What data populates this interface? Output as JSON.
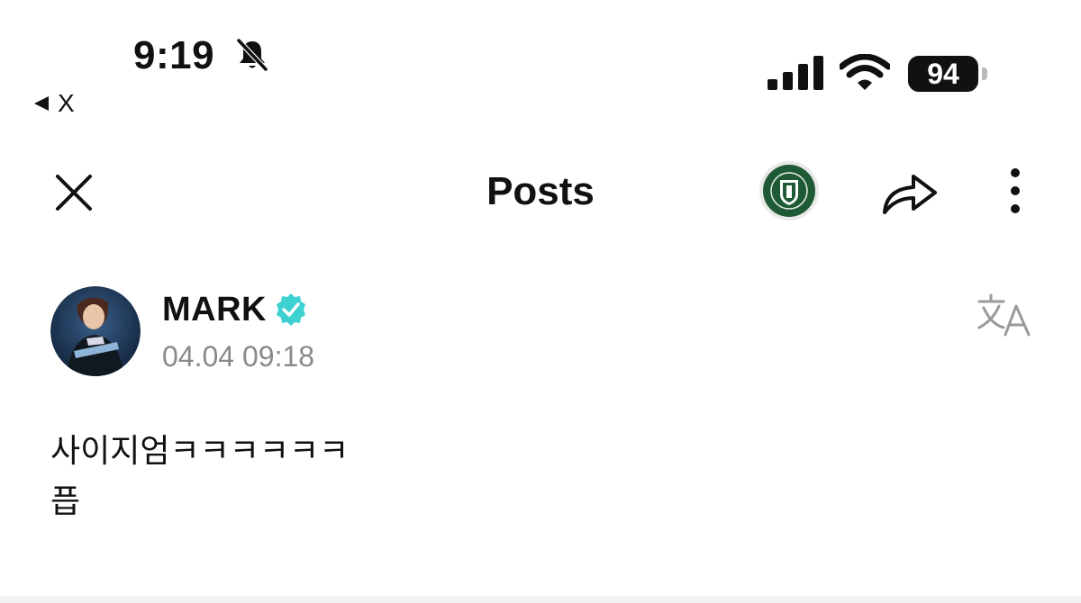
{
  "status_bar": {
    "time": "9:19",
    "battery": "94",
    "back_app_label": "X"
  },
  "header": {
    "title": "Posts"
  },
  "post": {
    "author_name": "MARK",
    "timestamp": "04.04 09:18",
    "body_line1": "사이지엄ㅋㅋㅋㅋㅋㅋ",
    "body_line2": "픕"
  },
  "icons": {
    "close": "close-icon",
    "share": "share-icon",
    "more": "more-vertical-icon",
    "badge": "group-badge-icon",
    "translate": "translate-icon",
    "verified": "verified-badge-icon",
    "bell": "bell-slash-icon"
  },
  "colors": {
    "verified": "#3ed1d1",
    "timestamp": "#8a8a8a",
    "badge_green": "#1e5a33"
  }
}
